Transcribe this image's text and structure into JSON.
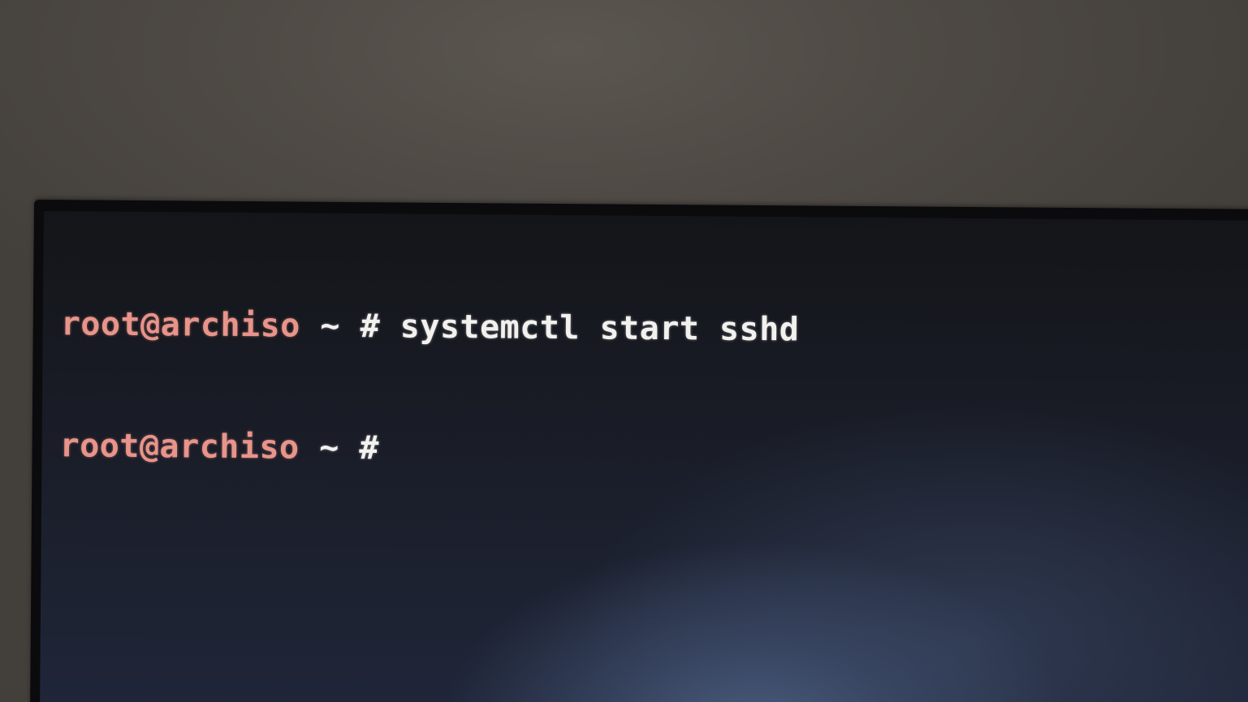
{
  "terminal": {
    "lines": [
      {
        "user_host": "root@archiso",
        "cwd": "~",
        "prompt_char": "#",
        "command": "systemctl start sshd"
      },
      {
        "user_host": "root@archiso",
        "cwd": "~",
        "prompt_char": "#",
        "command": ""
      }
    ]
  },
  "colors": {
    "user_host": "#e8948a",
    "text": "#f3f1ee",
    "background": "#1a1d27"
  }
}
